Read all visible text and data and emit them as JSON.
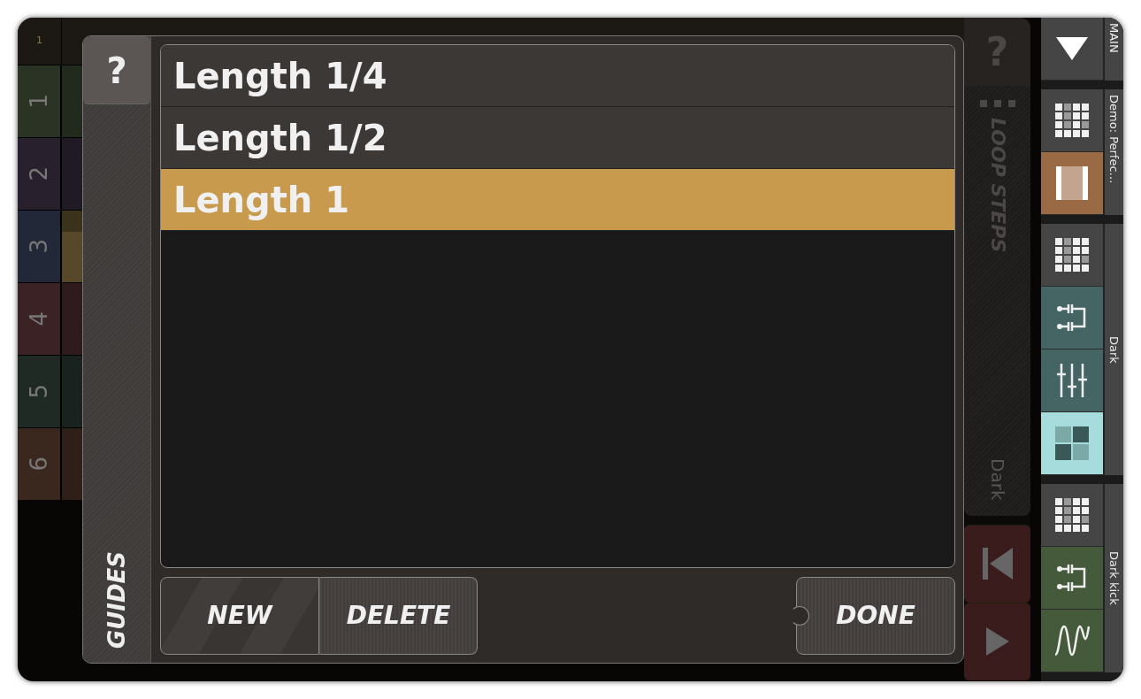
{
  "grid": {
    "corner": "1",
    "rows": [
      {
        "label": "1",
        "color": "#2b3324",
        "filled": false
      },
      {
        "label": "2",
        "color": "#28212d",
        "filled": false
      },
      {
        "label": "3",
        "color": "#232838",
        "filled": true
      },
      {
        "label": "4",
        "color": "#3a2225",
        "filled": false
      },
      {
        "label": "5",
        "color": "#1f2a25",
        "filled": false
      },
      {
        "label": "6",
        "color": "#3a271e",
        "filled": false
      }
    ]
  },
  "dialog": {
    "help": "?",
    "side_label": "GUIDES",
    "items": [
      {
        "label": "Length 1/4",
        "selected": false
      },
      {
        "label": "Length 1/2",
        "selected": false
      },
      {
        "label": "Length 1",
        "selected": true
      }
    ],
    "buttons": [
      {
        "label": "NEW",
        "kind": "striped"
      },
      {
        "label": "DELETE",
        "kind": "plain"
      },
      {
        "label": "DONE",
        "kind": "notched"
      }
    ]
  },
  "loop_panel": {
    "help": "?",
    "label": "LOOP STEPS",
    "pattern": "Dark"
  },
  "tracks": [
    {
      "name": "MAIN",
      "buttons": [
        {
          "kind": "menu",
          "color": "#454545"
        }
      ]
    },
    {
      "name": "Demo: Perfec…",
      "buttons": [
        {
          "kind": "grid",
          "color": "#454545"
        },
        {
          "kind": "bars",
          "color": "#9a6a45"
        }
      ]
    },
    {
      "name": "Dark",
      "buttons": [
        {
          "kind": "grid",
          "color": "#454545"
        },
        {
          "kind": "routing",
          "color": "#456564"
        },
        {
          "kind": "mixer",
          "color": "#456564"
        },
        {
          "kind": "pads",
          "color": "#a6dcdb"
        }
      ]
    },
    {
      "name": "Dark kick",
      "buttons": [
        {
          "kind": "grid",
          "color": "#454545"
        },
        {
          "kind": "routing",
          "color": "#445a3a"
        },
        {
          "kind": "wave",
          "color": "#445a3a"
        }
      ]
    }
  ]
}
